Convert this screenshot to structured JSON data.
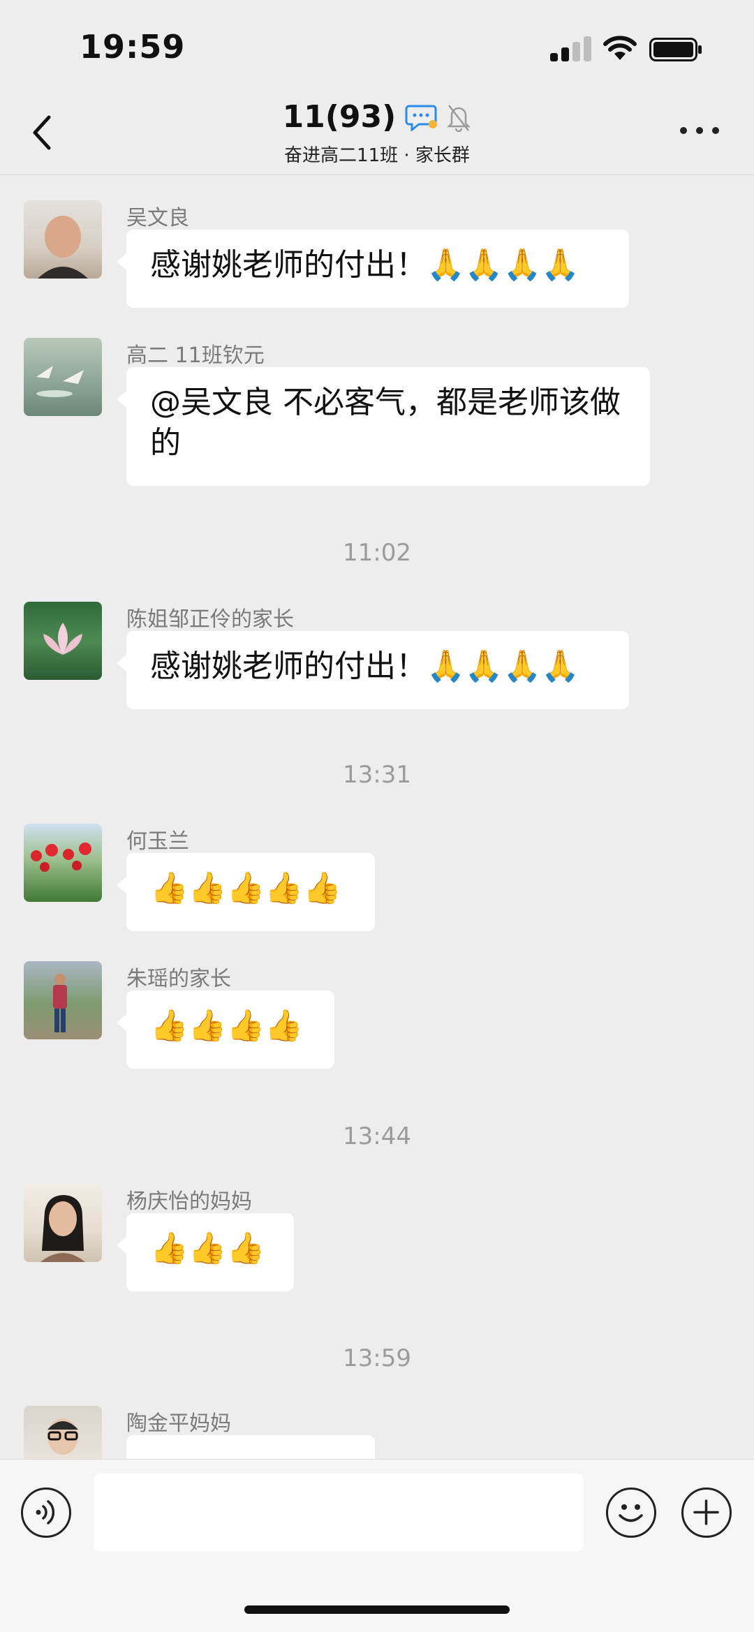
{
  "status": {
    "time": "19:59"
  },
  "header": {
    "title": "11(93)",
    "subtitle": "奋进高二11班 · 家长群"
  },
  "messages": [
    {
      "sender": "吴文良",
      "text": "感谢姚老师的付出！",
      "emoji": "🙏🙏🙏🙏"
    },
    {
      "sender": "高二 11班钦元",
      "text": "@吴文良 不必客气，都是老师该做的"
    },
    {
      "time": "11:02"
    },
    {
      "sender": "陈姐邹正伶的家长",
      "text": "感谢姚老师的付出！",
      "emoji": "🙏🙏🙏🙏"
    },
    {
      "time": "13:31"
    },
    {
      "sender": "何玉兰",
      "emoji": "👍👍👍👍👍"
    },
    {
      "sender": "朱瑶的家长",
      "emoji": "👍👍👍👍"
    },
    {
      "time": "13:44"
    },
    {
      "sender": "杨庆怡的妈妈",
      "emoji": "👍👍👍"
    },
    {
      "time": "13:59"
    },
    {
      "sender": "陶金平妈妈"
    }
  ],
  "input": {
    "placeholder": ""
  },
  "colors": {
    "background": "#ededed",
    "bubble": "#ffffff",
    "sender": "#7a7a7a",
    "timestamp": "#9b9b9b"
  }
}
